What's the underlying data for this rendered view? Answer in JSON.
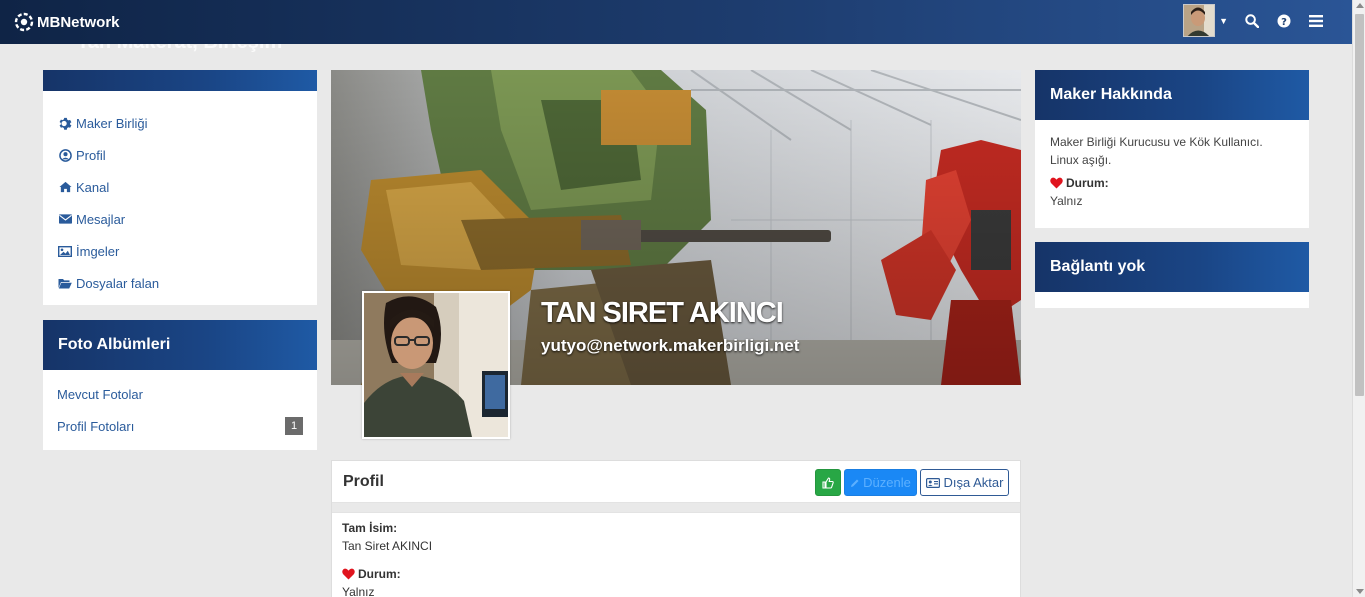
{
  "navbar": {
    "brand": "MBNetwork"
  },
  "ghost_title": "Tan Makerat, Birleşim",
  "sidebar": {
    "items": [
      {
        "label": "Maker Birliği",
        "icon": "gear-icon"
      },
      {
        "label": "Profil",
        "icon": "user-circle-icon"
      },
      {
        "label": "Kanal",
        "icon": "home-icon"
      },
      {
        "label": "Mesajlar",
        "icon": "envelope-icon"
      },
      {
        "label": "İmgeler",
        "icon": "image-icon"
      },
      {
        "label": "Dosyalar falan",
        "icon": "folder-open-icon"
      }
    ]
  },
  "albums": {
    "title": "Foto Albümleri",
    "items": [
      {
        "label": "Mevcut Fotolar"
      },
      {
        "label": "Profil Fotoları",
        "count": "1"
      }
    ]
  },
  "cover": {
    "name": "TAN SIRET AKINCI",
    "email": "yutyo@network.makerbirligi.net"
  },
  "profile": {
    "title": "Profil",
    "edit_label": "Düzenle",
    "export_label": "Dışa Aktar",
    "full_name_label": "Tam İsim:",
    "full_name": "Tan Siret AKINCI",
    "status_label": "Durum:",
    "status": "Yalnız"
  },
  "about": {
    "title": "Maker Hakkında",
    "text": "Maker Birliği Kurucusu ve Kök Kullanıcı. Linux aşığı.",
    "status_label": "Durum:",
    "status": "Yalnız"
  },
  "connections": {
    "title": "Bağlantı yok"
  },
  "colors": {
    "navbar": "#1d3c6e",
    "header_gradient": "#1a4585",
    "link": "#2a5b9b",
    "like_green": "#28a745",
    "edit_blue": "#1a88f5",
    "heart_red": "#e0141e"
  }
}
